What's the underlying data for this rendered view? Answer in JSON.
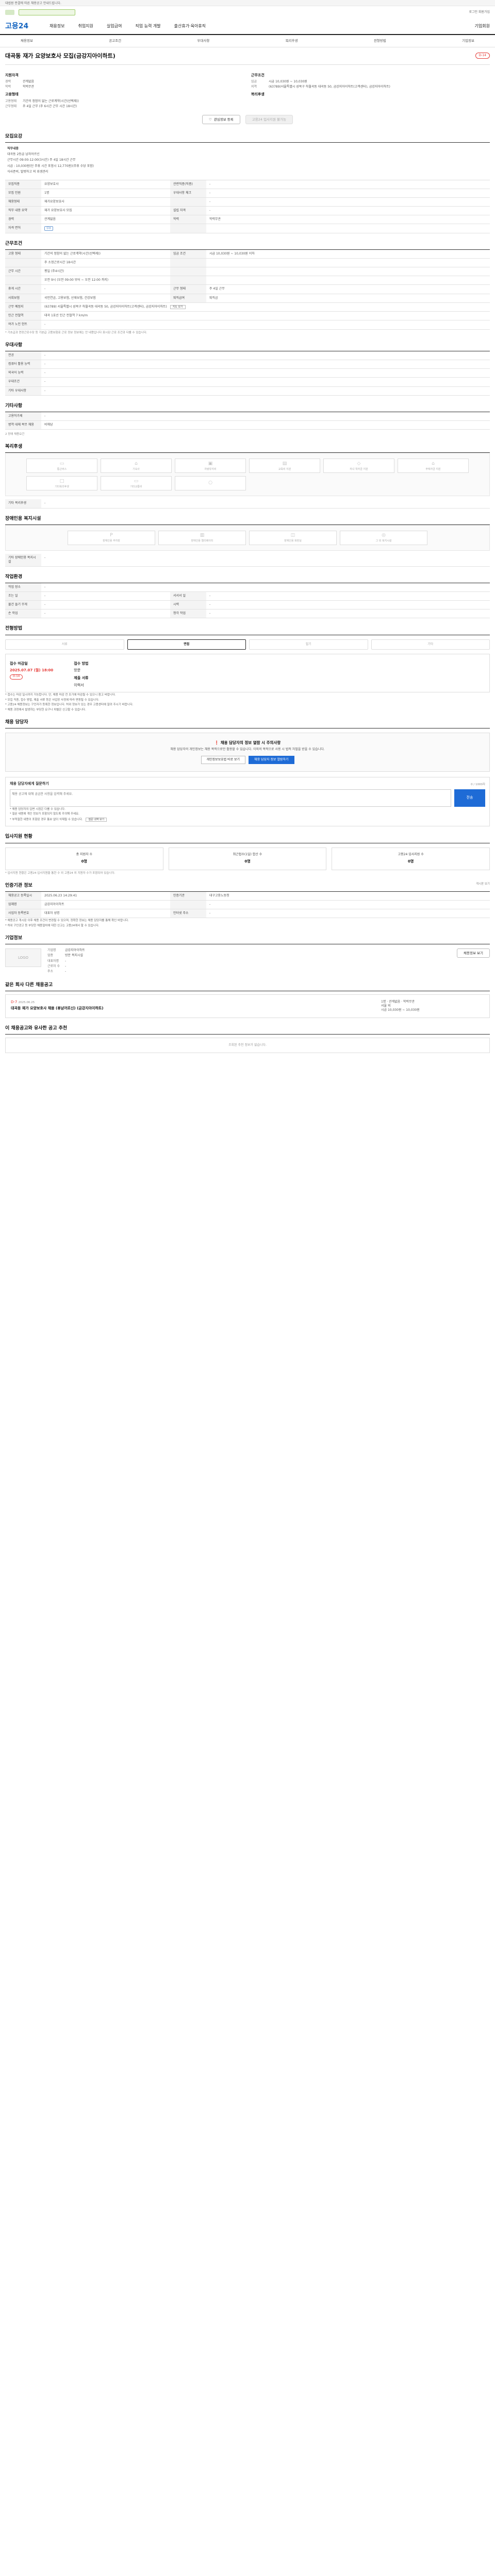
{
  "notice": "대법원 판결에 따른 채용공고 안내드립니다.",
  "logo": "고용24",
  "search": {
    "placeholder": "통합"
  },
  "top_right": "로그인 회원가입",
  "gnb": [
    "채용정보",
    "취업지원",
    "실업급여",
    "직업 능력 개발",
    "출산휴가·육아휴직",
    "기업회원"
  ],
  "subnav": [
    "채용정보",
    "공고조건",
    "우대사항",
    "복리후생",
    "전형방법",
    "기업정보"
  ],
  "title": "대곡동 재가 요양보호사 모집(금강지아이하트)",
  "dday": "D-14",
  "summary": {
    "left_title": "지원자격",
    "left": [
      {
        "k": "경력",
        "v": "관계없음"
      },
      {
        "k": "학력",
        "v": "학력무관"
      }
    ],
    "left2_title": "고용형태",
    "left2": [
      {
        "k": "고용형태",
        "v": "기간의 정함이 없는 근로계약(시간(선택제))"
      },
      {
        "k": "근무형태",
        "v": "주 4일 근무 (주 6시간 근무 시간 18시간)"
      }
    ],
    "right_title": "근무조건",
    "right": [
      {
        "k": "임금",
        "v": "시급 10,030원 ~ 10,030원"
      },
      {
        "k": "지역",
        "v": "(63789)서울특별시 성북구 하월곡동 대곡동 50, 금강지아이하트(고객센터), 금강지아이하트)"
      }
    ],
    "right2_title": "복리후생",
    "save": "관심정보 등록",
    "apply": "고용24 입사지원 불가능"
  },
  "job": {
    "heading": "모집요강",
    "desc_title": "직무내용",
    "desc": [
      "대곡동 2등급 남자어르신",
      "근무시간 09:00-12:00(3시간) 주 4일 18시간 근무",
      "시급 : 10,030원(단 주휴 시간 포함시 12,770원)(주휴 수당 포함)",
      "식사준비, 말벗하고 외 위생관리"
    ],
    "rows": [
      [
        "모집직종",
        "요양보호사",
        "관련직종(직종)",
        "-"
      ],
      [
        "모집 인원",
        "1명",
        "우대사항 체크",
        "-"
      ],
      [
        "채용형태",
        "재가요양보호사",
        "",
        "-"
      ],
      [
        "직무 내용 요약",
        "재가 요양보호사 모집",
        "설립 자격",
        "-"
      ],
      [
        "경력",
        "관계없음",
        "학력",
        "학력무관"
      ],
      [
        "자격 면허",
        "없음",
        "",
        ""
      ]
    ]
  },
  "cond": {
    "heading": "근무조건",
    "rows": [
      [
        "고용 형태",
        "기간의 정함이 없는 근로계약(시간(선택제))",
        "임금 조건",
        "시급 10,030원 ~ 10,030원 이하"
      ],
      [
        "",
        "주 소정근로시간 18시간",
        "",
        ""
      ],
      [
        "근무 시간",
        "평일 (주4시간)",
        "",
        ""
      ],
      [
        "",
        "오전 9시 (오전 09:00 부터 ~ 오전 12:00 까지)",
        "",
        ""
      ],
      [
        "휴게 시간",
        "-",
        "근무 형태",
        "주 4일 근무"
      ],
      [
        "사회보험",
        "국민연금, 고용보험, 산재보험, 건강보험",
        "퇴직급여",
        "퇴직금"
      ],
      [
        "근무 예정지",
        "(63789) 서울특별시 성북구 하월곡동 대곡동 50, 금강지아이하트(고객센터), 금강지아이하트)",
        "",
        ""
      ],
      [
        "인근 전철역",
        "대곡 1호선 인근 전철역 7 km/m",
        "",
        ""
      ],
      [
        "여가 노인 헌트",
        "-",
        "",
        ""
      ]
    ],
    "note": "* 기초급과 연장근로수당 등 기본급 고용보험료 근로 정보 정보에는 안 내용입니다 표시된 근로 조건과 다를 수 있습니다.",
    "map_btn": "지도 보기"
  },
  "pref": {
    "heading": "우대사항",
    "rows": [
      [
        "전공",
        "-"
      ],
      [
        "컴퓨터 활용 능력",
        "-"
      ],
      [
        "외국어 능력",
        "-"
      ],
      [
        "우대조건",
        "-"
      ],
      [
        "기타 우대사항",
        "-"
      ]
    ]
  },
  "etc": {
    "heading": "기타사항",
    "rows": [
      [
        "고용허가제",
        "-"
      ],
      [
        "병역 대체 복무 채용",
        "비해당"
      ]
    ],
    "disabled": "2 장애 채용요건"
  },
  "welfare": {
    "heading": "복리후생",
    "items": [
      "통근버스",
      "기숙사",
      "차량유지비",
      "교육비 지원",
      "자녀 학자금 지원",
      "주택자금 지원",
      "기타복리후생",
      "기타교통비",
      "",
      ""
    ],
    "extra_label": "기타 복리후생",
    "extra_val": "-"
  },
  "disfac": {
    "heading": "장애인용 복지시설",
    "items": [
      "장애인용 주차장",
      "장애인용 엘리베이터",
      "장애인용 화장실",
      "그 외 복지시설"
    ],
    "extra_label": "기타 장애인용 복지시설",
    "extra_val": "-"
  },
  "work": {
    "heading": "작업환경",
    "rows": [
      [
        "작업 장소",
        "-",
        "",
        ""
      ],
      [
        "조는 일",
        "-",
        "서서서 일",
        "-"
      ],
      [
        "물건 들기 무게",
        "-",
        "시력",
        "-"
      ],
      [
        "손 작업",
        "-",
        "청각 작업",
        "-"
      ]
    ]
  },
  "process": {
    "heading": "전형방법",
    "steps": [
      "서류",
      "면접",
      "필기",
      "기타"
    ],
    "period_label": "접수 마감일",
    "period": "2025.07.07 (월) 18:00",
    "dday": "D-14",
    "method_label": "접수 방법",
    "method": "방문",
    "docs_label": "제출 서류",
    "docs": "이력서",
    "bullets": [
      "* 접수는 마감 일시까지 가능합니다. 단, 채용 마감 전 조기에 마감될 수 있으니 참고 바랍니다.",
      "* 모집 직종, 접수 방법, 제출 서류 등은 사업장 사정에 따라 변동될 수 있습니다.",
      "* 고용24 채용정보는 구인자가 등록한 정보입니다. 허위 정보가 있는 경우 고용센터에 알려 주시기 바랍니다.",
      "* 채용 과정에서 발생하는 부당한 요구나 차별은 신고할 수 있습니다."
    ]
  },
  "contact": {
    "heading": "채용 담당자",
    "alert": "채용 담당자의 정보 열람 시 주의사항",
    "alert_text": "채용 담당자의 개인정보는 채용 목적으로만 활용할 수 있습니다. 이외의 목적으로 사용 시 법적 처벌을 받을 수 있습니다.",
    "btn1": "개인정보보호법 바로 보기",
    "btn2": "채용 담당자 정보 열람하기",
    "q_title": "채용 담당자에게 질문하기",
    "q_hint": "0 / 1000자",
    "q_placeholder": "채용 공고에 대해 궁금한 사항을 입력해 주세요.",
    "q_send": "전송",
    "q_bullets": [
      "* 채용 담당자의 답변 시점은 다를 수 있습니다.",
      "* 질문 내용에 개인 정보가 포함되지 않도록 주의해 주세요.",
      "* 부적절한 내용이 포함된 경우 통보 없이 삭제될 수 있습니다."
    ],
    "q_btn": "질문 내역 보기"
  },
  "status": {
    "heading": "입사지원 현황",
    "cards": [
      {
        "t": "총 지원자 수",
        "n": "0명"
      },
      {
        "t": "최근접수(1일) 합산 수",
        "n": "0명"
      },
      {
        "t": "고용24 입사지원 수",
        "n": "0명"
      }
    ],
    "note": "* 입사지원 현황은 고용24 입사지원을 통한 수 외 고용24 외 지원자 수가 포함되어 있습니다."
  },
  "info": {
    "heading": "인증기관 정보",
    "heading_btn": "게시판 보기",
    "rows": [
      [
        "채용공고 등록일시",
        "2025.06.23 14:29:41",
        "인증기관",
        "대구고용노동청"
      ],
      [
        "업체명",
        "금강지아이하트",
        "",
        "-"
      ],
      [
        "사업자 등록번호",
        "대표자 성명",
        "인터넷 주소",
        "-"
      ]
    ],
    "bullets": [
      "* 채용공고 게시된 이후 채용 조건이 변경될 수 있으며, 정확한 정보는 채용 담당자를 통해 확인 바랍니다.",
      "* 허위 구인광고 등 부당한 채용절차에 대한 신고는 고용24에서 할 수 있습니다."
    ]
  },
  "company": {
    "heading": "기업정보",
    "logo": "LOGO",
    "name_label": "기업명",
    "name": "금강지아이하트",
    "biz_label": "업종",
    "biz": "방문 복지시설",
    "rep_label": "대표자명",
    "rep": "-",
    "emp_label": "근로자 수",
    "emp": "-",
    "addr_label": "주소",
    "addr": "-",
    "btn": "채용정보 보기"
  },
  "same": {
    "heading": "같은 회사 다른 채용공고",
    "dday": "D-7",
    "date": "2025.06.25",
    "title": "대곡동 재가 요양보호사 채용 (휴남어르신) (금강지아이하트)",
    "tags": [
      "1명",
      "관계없음",
      "학력무관"
    ],
    "loc": "서울 외",
    "pay": "시급 10,030원 ~ 10,030원"
  },
  "similar": {
    "heading": "이 채용공고와 유사한 공고 추천",
    "empty": "조회된 추천 정보가 없습니다."
  }
}
